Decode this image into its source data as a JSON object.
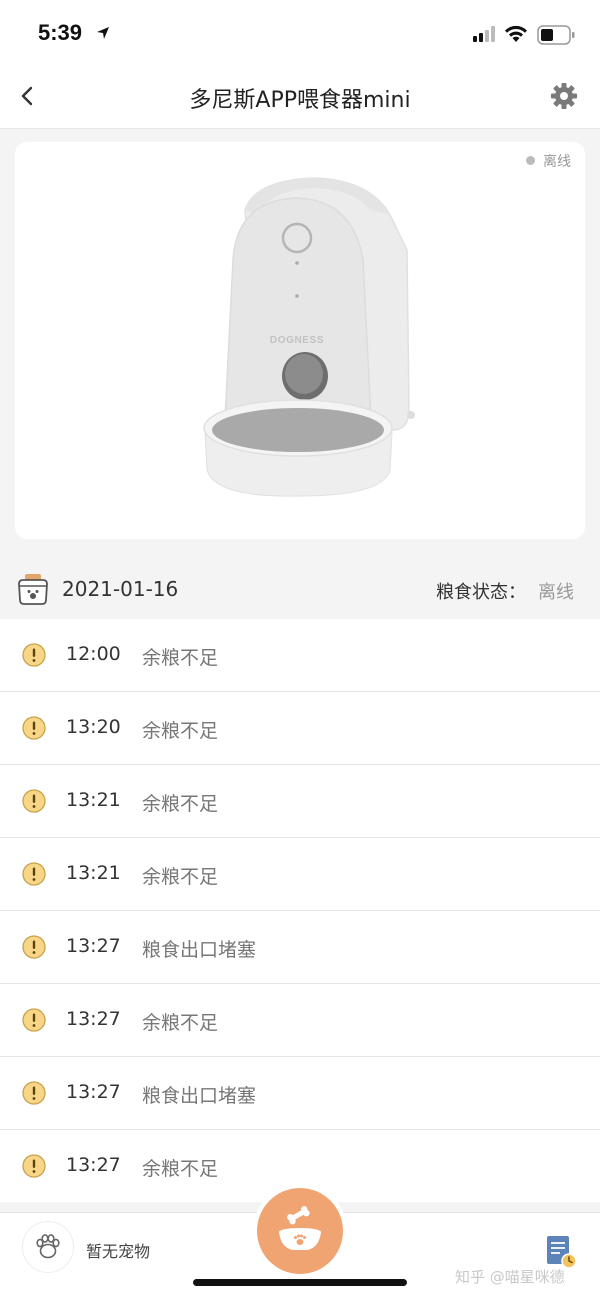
{
  "status_bar": {
    "time": "5:39"
  },
  "nav": {
    "title": "多尼斯APP喂食器mini"
  },
  "device": {
    "status": "离线",
    "brand": "DOGNESS",
    "status_color": "#bbbbbb"
  },
  "date_header": {
    "date": "2021-01-16",
    "food_status_label": "粮食状态：",
    "food_status_value": "离线"
  },
  "logs": [
    {
      "time": "12:00",
      "message": "余粮不足"
    },
    {
      "time": "13:20",
      "message": "余粮不足"
    },
    {
      "time": "13:21",
      "message": "余粮不足"
    },
    {
      "time": "13:21",
      "message": "余粮不足"
    },
    {
      "time": "13:27",
      "message": "粮食出口堵塞"
    },
    {
      "time": "13:27",
      "message": "余粮不足"
    },
    {
      "time": "13:27",
      "message": "粮食出口堵塞"
    },
    {
      "time": "13:27",
      "message": "余粮不足"
    }
  ],
  "bottom_bar": {
    "pet_label": "暂无宠物",
    "watermark": "知乎 @喵星咪德",
    "accent_color": "#f0a472"
  },
  "icons": [
    "location-arrow-icon",
    "signal-icon",
    "wifi-icon",
    "battery-icon",
    "back-icon",
    "gear-icon",
    "calendar-icon",
    "warning-icon",
    "paw-icon",
    "bowl-icon",
    "record-icon"
  ]
}
